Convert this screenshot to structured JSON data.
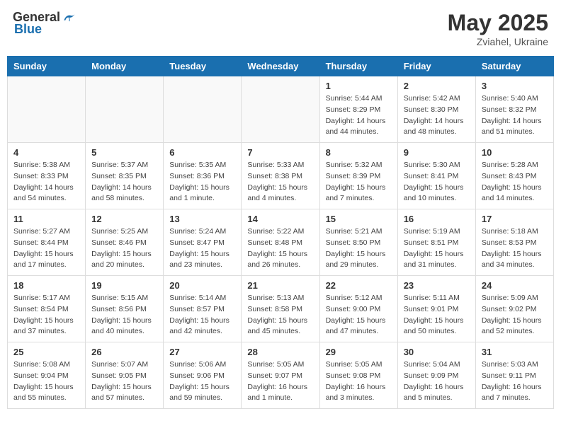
{
  "header": {
    "logo_general": "General",
    "logo_blue": "Blue",
    "title": "May 2025",
    "location": "Zviahel, Ukraine"
  },
  "weekdays": [
    "Sunday",
    "Monday",
    "Tuesday",
    "Wednesday",
    "Thursday",
    "Friday",
    "Saturday"
  ],
  "weeks": [
    [
      {
        "day": "",
        "info": ""
      },
      {
        "day": "",
        "info": ""
      },
      {
        "day": "",
        "info": ""
      },
      {
        "day": "",
        "info": ""
      },
      {
        "day": "1",
        "info": "Sunrise: 5:44 AM\nSunset: 8:29 PM\nDaylight: 14 hours\nand 44 minutes."
      },
      {
        "day": "2",
        "info": "Sunrise: 5:42 AM\nSunset: 8:30 PM\nDaylight: 14 hours\nand 48 minutes."
      },
      {
        "day": "3",
        "info": "Sunrise: 5:40 AM\nSunset: 8:32 PM\nDaylight: 14 hours\nand 51 minutes."
      }
    ],
    [
      {
        "day": "4",
        "info": "Sunrise: 5:38 AM\nSunset: 8:33 PM\nDaylight: 14 hours\nand 54 minutes."
      },
      {
        "day": "5",
        "info": "Sunrise: 5:37 AM\nSunset: 8:35 PM\nDaylight: 14 hours\nand 58 minutes."
      },
      {
        "day": "6",
        "info": "Sunrise: 5:35 AM\nSunset: 8:36 PM\nDaylight: 15 hours\nand 1 minute."
      },
      {
        "day": "7",
        "info": "Sunrise: 5:33 AM\nSunset: 8:38 PM\nDaylight: 15 hours\nand 4 minutes."
      },
      {
        "day": "8",
        "info": "Sunrise: 5:32 AM\nSunset: 8:39 PM\nDaylight: 15 hours\nand 7 minutes."
      },
      {
        "day": "9",
        "info": "Sunrise: 5:30 AM\nSunset: 8:41 PM\nDaylight: 15 hours\nand 10 minutes."
      },
      {
        "day": "10",
        "info": "Sunrise: 5:28 AM\nSunset: 8:43 PM\nDaylight: 15 hours\nand 14 minutes."
      }
    ],
    [
      {
        "day": "11",
        "info": "Sunrise: 5:27 AM\nSunset: 8:44 PM\nDaylight: 15 hours\nand 17 minutes."
      },
      {
        "day": "12",
        "info": "Sunrise: 5:25 AM\nSunset: 8:46 PM\nDaylight: 15 hours\nand 20 minutes."
      },
      {
        "day": "13",
        "info": "Sunrise: 5:24 AM\nSunset: 8:47 PM\nDaylight: 15 hours\nand 23 minutes."
      },
      {
        "day": "14",
        "info": "Sunrise: 5:22 AM\nSunset: 8:48 PM\nDaylight: 15 hours\nand 26 minutes."
      },
      {
        "day": "15",
        "info": "Sunrise: 5:21 AM\nSunset: 8:50 PM\nDaylight: 15 hours\nand 29 minutes."
      },
      {
        "day": "16",
        "info": "Sunrise: 5:19 AM\nSunset: 8:51 PM\nDaylight: 15 hours\nand 31 minutes."
      },
      {
        "day": "17",
        "info": "Sunrise: 5:18 AM\nSunset: 8:53 PM\nDaylight: 15 hours\nand 34 minutes."
      }
    ],
    [
      {
        "day": "18",
        "info": "Sunrise: 5:17 AM\nSunset: 8:54 PM\nDaylight: 15 hours\nand 37 minutes."
      },
      {
        "day": "19",
        "info": "Sunrise: 5:15 AM\nSunset: 8:56 PM\nDaylight: 15 hours\nand 40 minutes."
      },
      {
        "day": "20",
        "info": "Sunrise: 5:14 AM\nSunset: 8:57 PM\nDaylight: 15 hours\nand 42 minutes."
      },
      {
        "day": "21",
        "info": "Sunrise: 5:13 AM\nSunset: 8:58 PM\nDaylight: 15 hours\nand 45 minutes."
      },
      {
        "day": "22",
        "info": "Sunrise: 5:12 AM\nSunset: 9:00 PM\nDaylight: 15 hours\nand 47 minutes."
      },
      {
        "day": "23",
        "info": "Sunrise: 5:11 AM\nSunset: 9:01 PM\nDaylight: 15 hours\nand 50 minutes."
      },
      {
        "day": "24",
        "info": "Sunrise: 5:09 AM\nSunset: 9:02 PM\nDaylight: 15 hours\nand 52 minutes."
      }
    ],
    [
      {
        "day": "25",
        "info": "Sunrise: 5:08 AM\nSunset: 9:04 PM\nDaylight: 15 hours\nand 55 minutes."
      },
      {
        "day": "26",
        "info": "Sunrise: 5:07 AM\nSunset: 9:05 PM\nDaylight: 15 hours\nand 57 minutes."
      },
      {
        "day": "27",
        "info": "Sunrise: 5:06 AM\nSunset: 9:06 PM\nDaylight: 15 hours\nand 59 minutes."
      },
      {
        "day": "28",
        "info": "Sunrise: 5:05 AM\nSunset: 9:07 PM\nDaylight: 16 hours\nand 1 minute."
      },
      {
        "day": "29",
        "info": "Sunrise: 5:05 AM\nSunset: 9:08 PM\nDaylight: 16 hours\nand 3 minutes."
      },
      {
        "day": "30",
        "info": "Sunrise: 5:04 AM\nSunset: 9:09 PM\nDaylight: 16 hours\nand 5 minutes."
      },
      {
        "day": "31",
        "info": "Sunrise: 5:03 AM\nSunset: 9:11 PM\nDaylight: 16 hours\nand 7 minutes."
      }
    ]
  ]
}
